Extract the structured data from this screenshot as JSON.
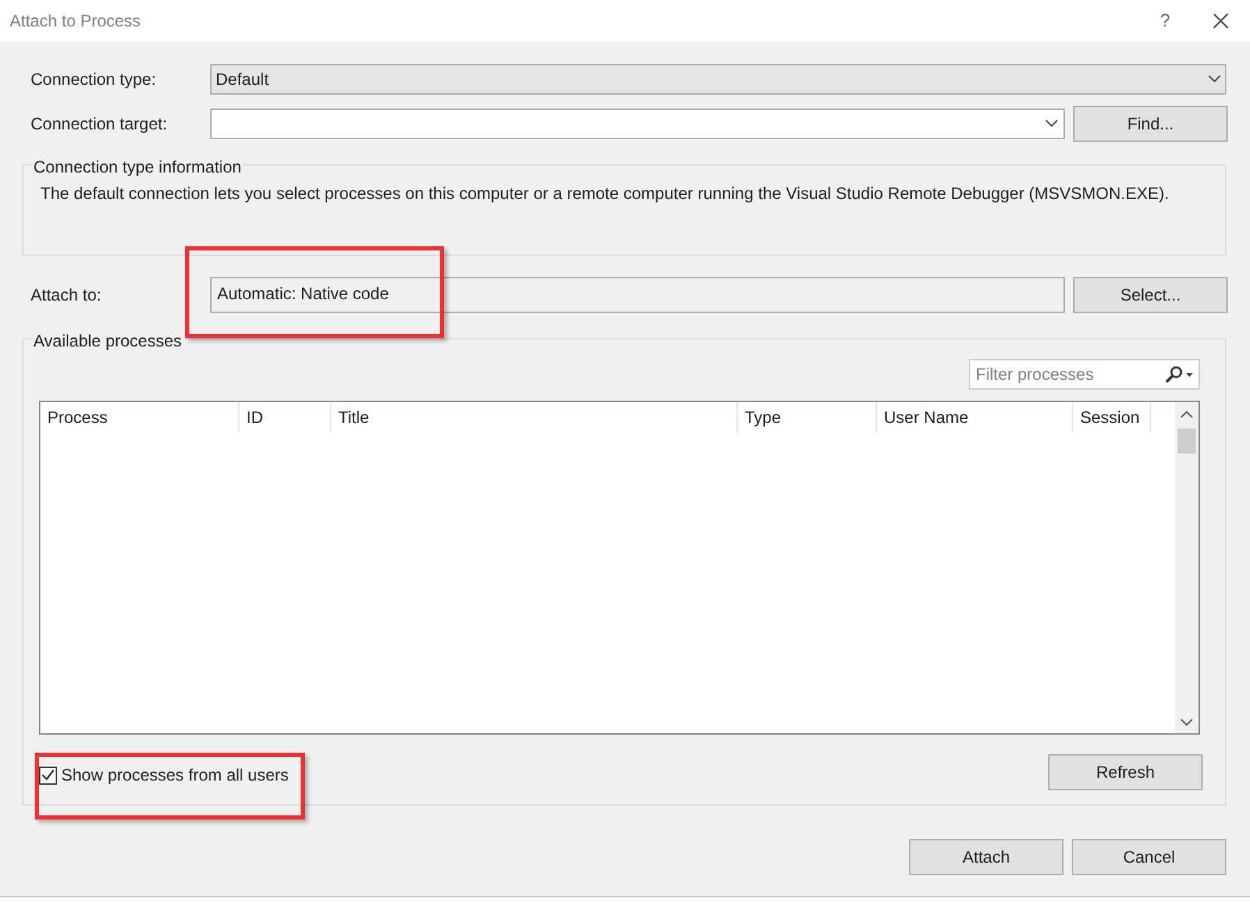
{
  "window": {
    "title": "Attach to Process",
    "help": "?"
  },
  "connection_type": {
    "label": "Connection type:",
    "value": "Default"
  },
  "connection_target": {
    "label": "Connection target:",
    "button": "Find..."
  },
  "info_group": {
    "title": "Connection type information",
    "text": "The default connection lets you select processes on this computer or a remote computer running the Visual Studio Remote Debugger (MSVSMON.EXE)."
  },
  "attach_to": {
    "label": "Attach to:",
    "value": "Automatic: Native code",
    "button": "Select..."
  },
  "processes": {
    "title": "Available processes",
    "filter": {
      "placeholder": "Filter processes"
    },
    "table": {
      "columns": [
        "Process",
        "ID",
        "Title",
        "Type",
        "User Name",
        "Session"
      ]
    },
    "show_all_users": {
      "label": "Show processes from all users",
      "checked": true
    },
    "refresh": "Refresh"
  },
  "buttons": [
    "Attach",
    "Cancel"
  ]
}
